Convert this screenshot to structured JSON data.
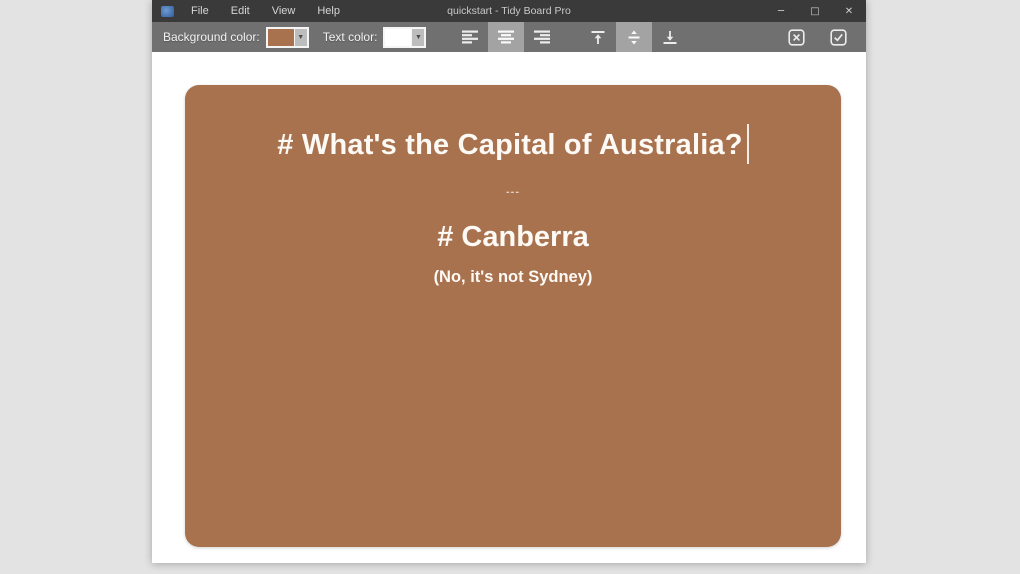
{
  "window": {
    "title": "quickstart - Tidy Board Pro",
    "menu_items": [
      "File",
      "Edit",
      "View",
      "Help"
    ],
    "controls": {
      "minimize": "─",
      "maximize": "□",
      "close": "✕"
    }
  },
  "toolbar": {
    "background_color": {
      "label": "Background color:",
      "value": "#a8724f"
    },
    "text_color": {
      "label": "Text color:",
      "value": "#ffffff"
    },
    "horizontal_align": {
      "options": [
        "left",
        "center",
        "right"
      ],
      "selected": "center"
    },
    "vertical_align": {
      "options": [
        "top",
        "middle",
        "bottom"
      ],
      "selected": "middle"
    },
    "actions": [
      "discard",
      "apply"
    ]
  },
  "icons": {
    "dropdown": "▼"
  },
  "editor": {
    "card": {
      "background_color": "#a8724f",
      "question": "# What's the Capital of Australia?",
      "separator": "---",
      "answer": "# Canberra",
      "note": "(No, it's not Sydney)",
      "caret_visible": true
    }
  },
  "colors": {
    "desktop_bg": "#e3e3e3",
    "titlebar_bg": "#3a3a3a",
    "toolbar_bg": "#707070",
    "toolbar_active_bg": "#a3a3a3",
    "card_bg": "#a8724f",
    "card_text": "#fdf9f5"
  }
}
